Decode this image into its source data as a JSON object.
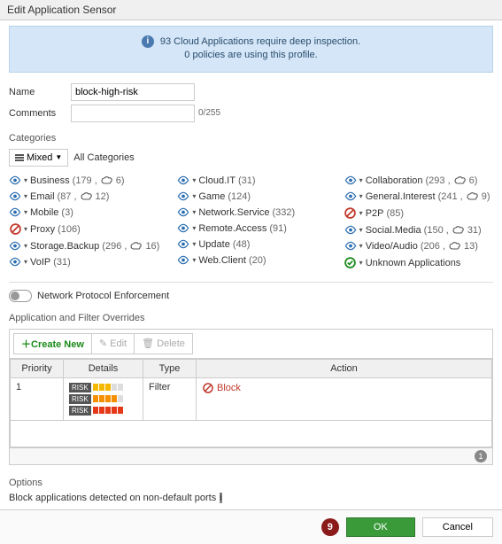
{
  "header": {
    "title": "Edit Application Sensor"
  },
  "banner": {
    "line1": "93 Cloud Applications require deep inspection.",
    "line2": "0 policies are using this profile."
  },
  "form": {
    "name_label": "Name",
    "name_value": "block-high-risk",
    "comments_label": "Comments",
    "comments_value": "",
    "comments_count": "0/255"
  },
  "categories": {
    "title": "Categories",
    "mixed_btn": "Mixed",
    "all_btn": "All Categories",
    "cols": [
      [
        {
          "action": "monitor",
          "name": "Business",
          "count": "179",
          "cloud": "6"
        },
        {
          "action": "monitor",
          "name": "Email",
          "count": "87",
          "cloud": "12"
        },
        {
          "action": "monitor",
          "name": "Mobile",
          "count": "3"
        },
        {
          "action": "block",
          "name": "Proxy",
          "count": "106"
        },
        {
          "action": "monitor",
          "name": "Storage.Backup",
          "count": "296",
          "cloud": "16"
        },
        {
          "action": "monitor",
          "name": "VoIP",
          "count": "31"
        }
      ],
      [
        {
          "action": "monitor",
          "name": "Cloud.IT",
          "count": "31"
        },
        {
          "action": "monitor",
          "name": "Game",
          "count": "124"
        },
        {
          "action": "monitor",
          "name": "Network.Service",
          "count": "332"
        },
        {
          "action": "monitor",
          "name": "Remote.Access",
          "count": "91"
        },
        {
          "action": "monitor",
          "name": "Update",
          "count": "48"
        },
        {
          "action": "monitor",
          "name": "Web.Client",
          "count": "20"
        }
      ],
      [
        {
          "action": "monitor",
          "name": "Collaboration",
          "count": "293",
          "cloud": "6"
        },
        {
          "action": "monitor",
          "name": "General.Interest",
          "count": "241",
          "cloud": "9"
        },
        {
          "action": "block",
          "name": "P2P",
          "count": "85"
        },
        {
          "action": "monitor",
          "name": "Social.Media",
          "count": "150",
          "cloud": "31"
        },
        {
          "action": "monitor",
          "name": "Video/Audio",
          "count": "206",
          "cloud": "13"
        },
        {
          "action": "allow",
          "name": "Unknown Applications"
        }
      ]
    ]
  },
  "npe": {
    "label": "Network Protocol Enforcement"
  },
  "overrides": {
    "title": "Application and Filter Overrides",
    "create": "Create New",
    "edit": "Edit",
    "delete": "Delete",
    "headers": {
      "priority": "Priority",
      "details": "Details",
      "type": "Type",
      "action": "Action"
    },
    "row": {
      "priority": "1",
      "risk_label": "RISK",
      "type": "Filter",
      "action": "Block"
    },
    "page": "1"
  },
  "options": {
    "title": "Options",
    "truncated": "Block applications detected on non-default ports"
  },
  "footer": {
    "step": "9",
    "ok": "OK",
    "cancel": "Cancel"
  }
}
